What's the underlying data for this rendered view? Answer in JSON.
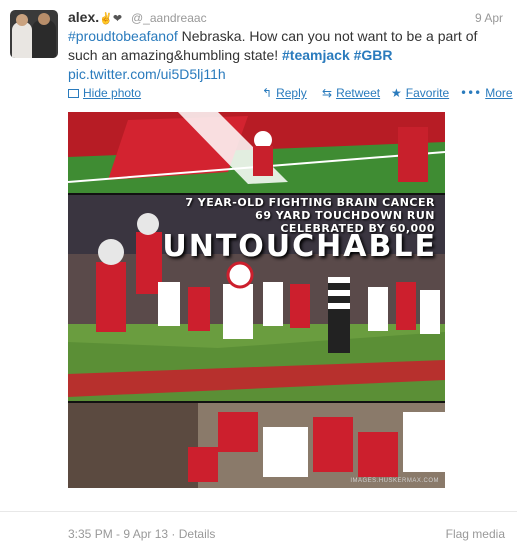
{
  "tweet": {
    "name": "alex.",
    "name_emoji": "✌❤",
    "handle": "@_aandreaac",
    "date": "9 Apr",
    "text": {
      "hashtag1": "#proudtobeafanof",
      "body": " Nebraska. How can you not want to be a part of such an amazing&humbling state! ",
      "hashtag2": "#teamjack",
      "hashtag3": "#GBR",
      "link": "pic.twitter.com/ui5D5lj11h"
    }
  },
  "actions": {
    "hide_photo": "Hide photo",
    "reply": "Reply",
    "retweet": "Retweet",
    "favorite": "Favorite",
    "more": "More"
  },
  "icons": {
    "reply": "↰",
    "retweet": "⇆",
    "favorite": "★",
    "more": "•••"
  },
  "photo": {
    "caption_line1": "7 YEAR-OLD FIGHTING BRAIN CANCER",
    "caption_line2": "69 YARD TOUCHDOWN RUN",
    "caption_line3": "CELEBRATED BY 60,000",
    "headline": "UNTOUCHABLE",
    "credit": "IMAGES.HUSKERMAX.COM"
  },
  "footer": {
    "timestamp": "3:35 PM - 9 Apr 13",
    "separator": " · ",
    "details": "Details",
    "flag_media": "Flag media"
  },
  "colors": {
    "link": "#2a7bbd",
    "muted": "#999999",
    "husker_red": "#cc1f2d"
  }
}
